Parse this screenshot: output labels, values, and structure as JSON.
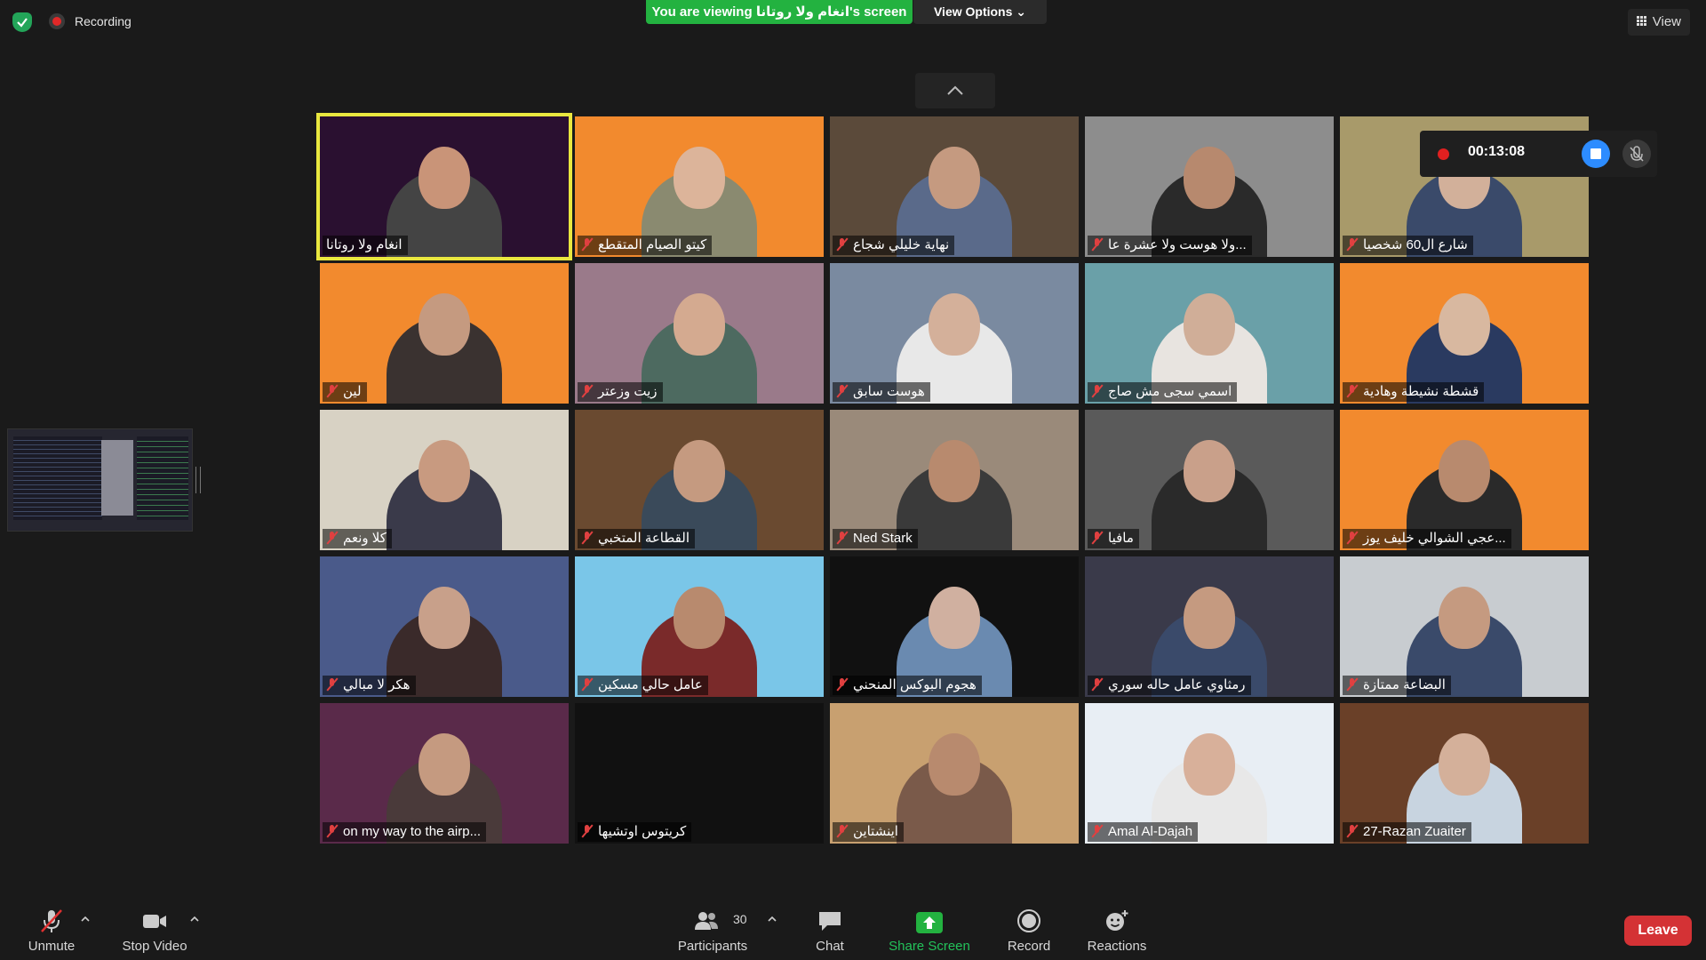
{
  "topbar": {
    "recording_label": "Recording",
    "viewing_banner": "You are viewing انغام ولا روتانا's screen",
    "view_options_label": "View Options ⌄",
    "view_label": "View"
  },
  "recording_panel": {
    "elapsed": "00:13:08"
  },
  "participants": [
    {
      "name": "انغام ولا روتانا",
      "muted": false,
      "active": true,
      "bg": "#2a1030",
      "skin": "#c99478",
      "clothes": "#444"
    },
    {
      "name": "كيتو الصيام المتقطع",
      "muted": true,
      "active": false,
      "bg": "#f28a2e",
      "skin": "#dcb49a",
      "clothes": "#8a8a70"
    },
    {
      "name": "نهاية خليلي شجاع",
      "muted": true,
      "active": false,
      "bg": "#5b4a3a",
      "skin": "#c59a80",
      "clothes": "#5a6a8a"
    },
    {
      "name": "ولا هوست ولا عشرة عا...",
      "muted": true,
      "active": false,
      "bg": "#8d8d8d",
      "skin": "#b7896e",
      "clothes": "#2a2a2a"
    },
    {
      "name": "شارع ال60 شخصيا",
      "muted": true,
      "active": false,
      "bg": "#a89a6a",
      "skin": "#d2b09a",
      "clothes": "#3a4a6a"
    },
    {
      "name": "لين",
      "muted": true,
      "active": false,
      "bg": "#f28a2e",
      "skin": "#c59a80",
      "clothes": "#3a3230"
    },
    {
      "name": "زيت وزعتر",
      "muted": true,
      "active": false,
      "bg": "#9a7a8a",
      "skin": "#d4aa90",
      "clothes": "#4d6a60"
    },
    {
      "name": "هوست سابق",
      "muted": true,
      "active": false,
      "bg": "#7a8aa0",
      "skin": "#d4b09a",
      "clothes": "#e8e8e8"
    },
    {
      "name": "اسمي سجى مش صاج",
      "muted": true,
      "active": false,
      "bg": "#6aa0a8",
      "skin": "#d0ae98",
      "clothes": "#e8e4e0"
    },
    {
      "name": "قشطة نشيطة وهادية",
      "muted": true,
      "active": false,
      "bg": "#f28a2e",
      "skin": "#d8b8a0",
      "clothes": "#2a3a60"
    },
    {
      "name": "كلا ونعم",
      "muted": true,
      "active": false,
      "bg": "#d8d2c4",
      "skin": "#c89a80",
      "clothes": "#3a3a4a"
    },
    {
      "name": "القطاعة المتخبي",
      "muted": true,
      "active": false,
      "bg": "#6a4a30",
      "skin": "#c59a80",
      "clothes": "#3a4a5a"
    },
    {
      "name": "Ned Stark",
      "muted": true,
      "active": false,
      "bg": "#9a8a7a",
      "skin": "#b88a6e",
      "clothes": "#3a3a3a"
    },
    {
      "name": "مافيا",
      "muted": true,
      "active": false,
      "bg": "#5a5a5a",
      "skin": "#c9a08a",
      "clothes": "#2a2a2a"
    },
    {
      "name": "عجي الشوالي خليف يوز...",
      "muted": true,
      "active": false,
      "bg": "#f28a2e",
      "skin": "#b88a6e",
      "clothes": "#2a2a2a"
    },
    {
      "name": "هكر لا مبالي",
      "muted": true,
      "active": false,
      "bg": "#4a5a8a",
      "skin": "#c8a08a",
      "clothes": "#3a2a2a"
    },
    {
      "name": "عامل حالي مسكين",
      "muted": true,
      "active": false,
      "bg": "#7ac6e8",
      "skin": "#b88a6e",
      "clothes": "#7a2a2a"
    },
    {
      "name": "هجوم البوكس المنحني",
      "muted": true,
      "active": false,
      "bg": "#111111",
      "skin": "#d0b0a0",
      "clothes": "#6a8ab0"
    },
    {
      "name": "رمثاوي عامل حاله سوري",
      "muted": true,
      "active": false,
      "bg": "#3a3a4a",
      "skin": "#c59a80",
      "clothes": "#3a4a6a"
    },
    {
      "name": "البضاعة ممتازة",
      "muted": true,
      "active": false,
      "bg": "#c8ccd0",
      "skin": "#c59a80",
      "clothes": "#3a4a6a"
    },
    {
      "name": "on my way to the airp...",
      "muted": true,
      "active": false,
      "bg": "#5a2a4a",
      "skin": "#c59a80",
      "clothes": "#4a3a3a"
    },
    {
      "name": "كريتوس اوتشيها",
      "muted": true,
      "active": false,
      "bg": "#111111",
      "skin": "",
      "clothes": ""
    },
    {
      "name": "اينشتاين",
      "muted": true,
      "active": false,
      "bg": "#c8a070",
      "skin": "#b88a6e",
      "clothes": "#7a5a4a"
    },
    {
      "name": "Amal Al-Dajah",
      "muted": true,
      "active": false,
      "bg": "#e8eef4",
      "skin": "#d8b09a",
      "clothes": "#e8e8e8"
    },
    {
      "name": "27-Razan Zuaiter",
      "muted": true,
      "active": false,
      "bg": "#6a4028",
      "skin": "#d4b09a",
      "clothes": "#c8d4e0"
    }
  ],
  "toolbar": {
    "unmute": "Unmute",
    "stop_video": "Stop Video",
    "participants": "Participants",
    "participants_count": "30",
    "chat": "Chat",
    "share_screen": "Share Screen",
    "record": "Record",
    "reactions": "Reactions",
    "leave": "Leave"
  }
}
